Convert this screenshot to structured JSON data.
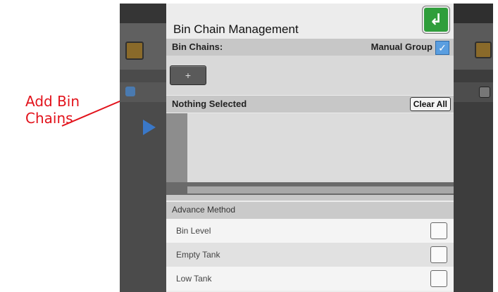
{
  "annotation": {
    "line1": "Add Bin",
    "line2": "Chains"
  },
  "dialog": {
    "title": "Bin Chain Management",
    "bin_chains_label": "Bin Chains:",
    "manual_group_label": "Manual Group",
    "manual_group_checked": true,
    "add_button_label": "+",
    "selection_status": "Nothing Selected",
    "clear_all_label": "Clear All",
    "advance_method_label": "Advance Method",
    "advance_options": [
      {
        "label": "Bin Level",
        "checked": false
      },
      {
        "label": "Empty Tank",
        "checked": false
      },
      {
        "label": "Low Tank",
        "checked": false
      }
    ]
  },
  "colors": {
    "annotation": "#e2121b",
    "back_button": "#2f9e3b",
    "checkbox_checked": "#5a9ee0"
  },
  "icons": {
    "back": "return-arrow-icon",
    "check": "checkmark-icon"
  }
}
